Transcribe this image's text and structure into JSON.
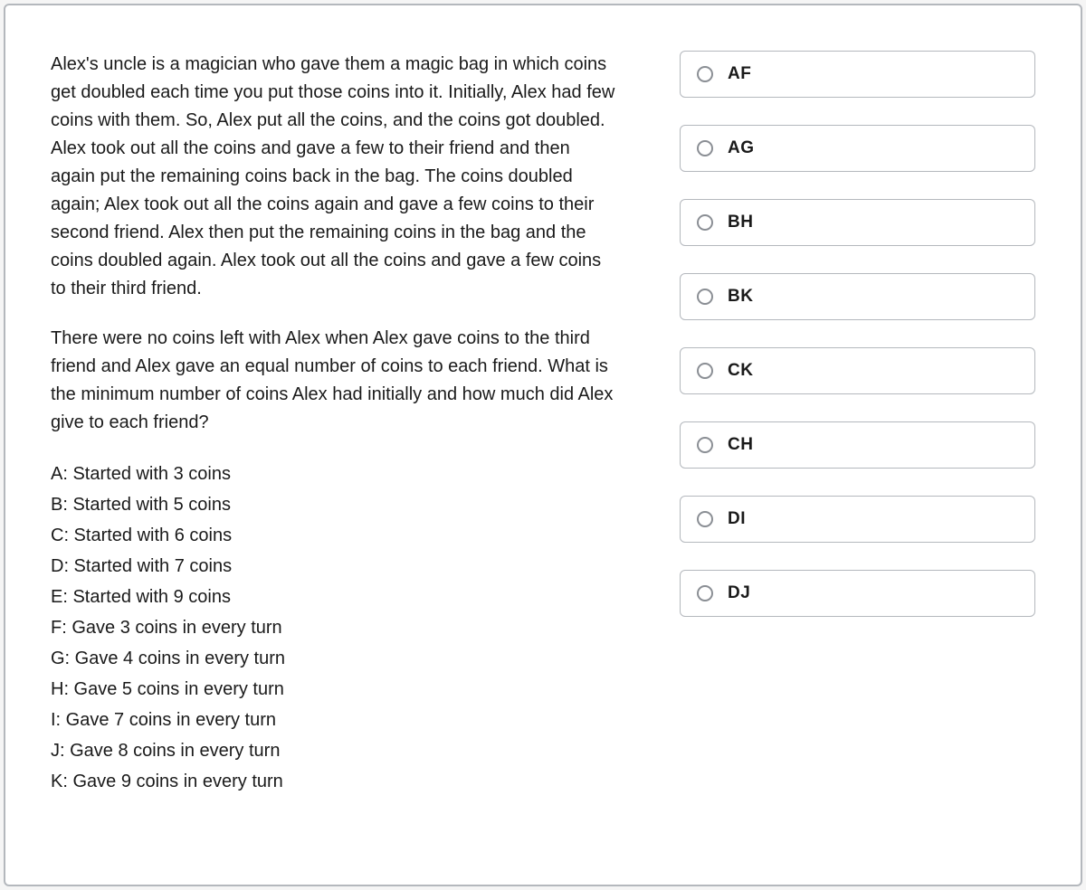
{
  "question": {
    "para1": "Alex's uncle is a magician who gave them a magic bag in which coins get doubled each time you put those coins into it. Initially, Alex had few coins with them. So, Alex put all the coins, and the coins got doubled. Alex took out all the coins and gave a few to their friend and then again put the remaining coins back in the bag. The coins doubled again; Alex took out all the coins again and gave a few coins to their second friend. Alex then put the remaining coins in the bag and the coins doubled again. Alex took out all the coins and gave a few coins to their third friend.",
    "para2": "There were no coins left with Alex when Alex gave coins to the third friend and Alex gave an equal number of coins to each friend. What is the minimum number of coins Alex had initially and how much did Alex give to each friend?"
  },
  "statement_options": [
    "A: Started with 3 coins",
    "B: Started with 5 coins",
    "C: Started with 6 coins",
    "D: Started with 7 coins",
    "E: Started with 9 coins",
    "F: Gave 3 coins in every turn",
    "G: Gave 4 coins in every turn",
    "H: Gave 5 coins in every turn",
    "I: Gave 7 coins in every turn",
    "J: Gave 8 coins in every turn",
    "K: Gave 9 coins in every turn"
  ],
  "answer_choices": [
    "AF",
    "AG",
    "BH",
    "BK",
    "CK",
    "CH",
    "DI",
    "DJ"
  ]
}
